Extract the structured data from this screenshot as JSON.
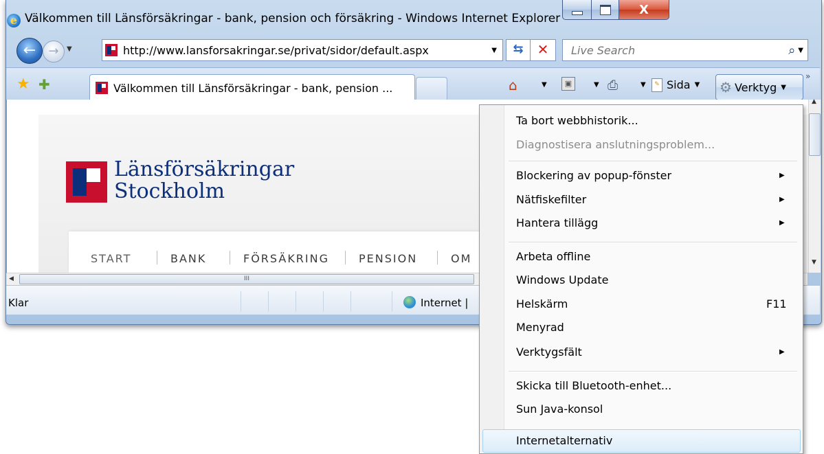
{
  "window": {
    "title": "Välkommen till Länsförsäkringar - bank, pension och försäkring - Windows Internet Explorer",
    "close_glyph": "X"
  },
  "address_bar": {
    "url": "http://www.lansforsakringar.se/privat/sidor/default.aspx"
  },
  "search": {
    "placeholder": "Live Search"
  },
  "tabs": [
    {
      "label": "Välkommen till Länsförsäkringar - bank, pension ..."
    }
  ],
  "command_bar": {
    "page_label": "Sida",
    "tools_label": "Verktyg"
  },
  "page": {
    "logo_line1": "Länsförsäkringar",
    "logo_line2": "Stockholm",
    "nav": [
      "START",
      "BANK",
      "FÖRSÄKRING",
      "PENSION",
      "OM"
    ]
  },
  "statusbar": {
    "status": "Klar",
    "zone": "Internet |"
  },
  "scrollbar": {
    "thumb_grip": "III"
  },
  "tools_menu": {
    "items": [
      {
        "label": "Ta bort webbhistorik..."
      },
      {
        "label": "Diagnostisera anslutningsproblem...",
        "disabled": true
      },
      {
        "label": "Blockering av popup-fönster",
        "submenu": true
      },
      {
        "label": "Nätfiskefilter",
        "submenu": true
      },
      {
        "label": "Hantera tillägg",
        "submenu": true
      },
      {
        "label": "Arbeta offline"
      },
      {
        "label": "Windows Update"
      },
      {
        "label": "Helskärm",
        "shortcut": "F11"
      },
      {
        "label": "Menyrad"
      },
      {
        "label": "Verktygsfält",
        "submenu": true
      },
      {
        "label": "Skicka till Bluetooth-enhet..."
      },
      {
        "label": "Sun Java-konsol"
      },
      {
        "label": "Internetalternativ",
        "highlighted": true
      }
    ]
  },
  "colors": {
    "brand_red": "#c8102e",
    "brand_blue": "#0b2f7a",
    "menu_highlight": "#dcecfa"
  }
}
